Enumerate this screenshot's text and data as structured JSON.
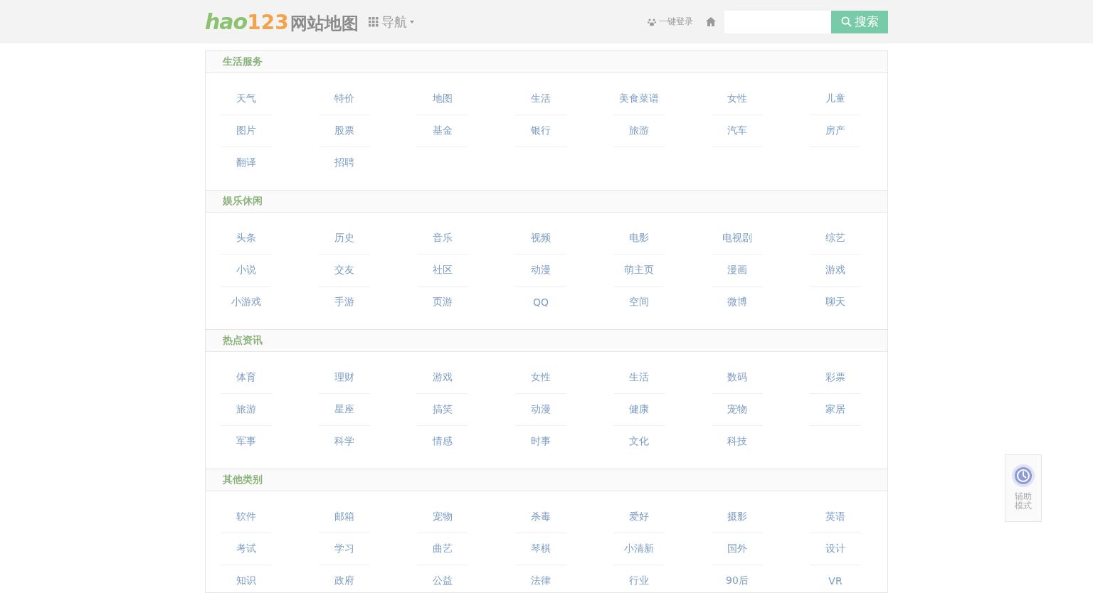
{
  "header": {
    "logo_brand": "hao",
    "logo_number": "123",
    "logo_title": "网站地图",
    "nav_label": "导航",
    "login_label": "一键登录",
    "search_button": "搜索"
  },
  "sections": [
    {
      "title": "生活服务",
      "links": [
        "天气",
        "特价",
        "地图",
        "生活",
        "美食菜谱",
        "女性",
        "儿童",
        "图片",
        "股票",
        "基金",
        "银行",
        "旅游",
        "汽车",
        "房产",
        "翻译",
        "招聘"
      ]
    },
    {
      "title": "娱乐休闲",
      "links": [
        "头条",
        "历史",
        "音乐",
        "视频",
        "电影",
        "电视剧",
        "综艺",
        "小说",
        "交友",
        "社区",
        "动漫",
        "萌主页",
        "漫画",
        "游戏",
        "小游戏",
        "手游",
        "页游",
        "QQ",
        "空间",
        "微博",
        "聊天"
      ]
    },
    {
      "title": "热点资讯",
      "links": [
        "体育",
        "理财",
        "游戏",
        "女性",
        "生活",
        "数码",
        "彩票",
        "旅游",
        "星座",
        "搞笑",
        "动漫",
        "健康",
        "宠物",
        "家居",
        "军事",
        "科学",
        "情感",
        "时事",
        "文化",
        "科技"
      ]
    },
    {
      "title": "其他类别",
      "links": [
        "软件",
        "邮箱",
        "宠物",
        "杀毒",
        "爱好",
        "摄影",
        "英语",
        "考试",
        "学习",
        "曲艺",
        "琴棋",
        "小清新",
        "国外",
        "设计",
        "知识",
        "政府",
        "公益",
        "法律",
        "行业",
        "90后",
        "VR"
      ]
    }
  ],
  "assist_widget": {
    "label": "辅助模式"
  }
}
